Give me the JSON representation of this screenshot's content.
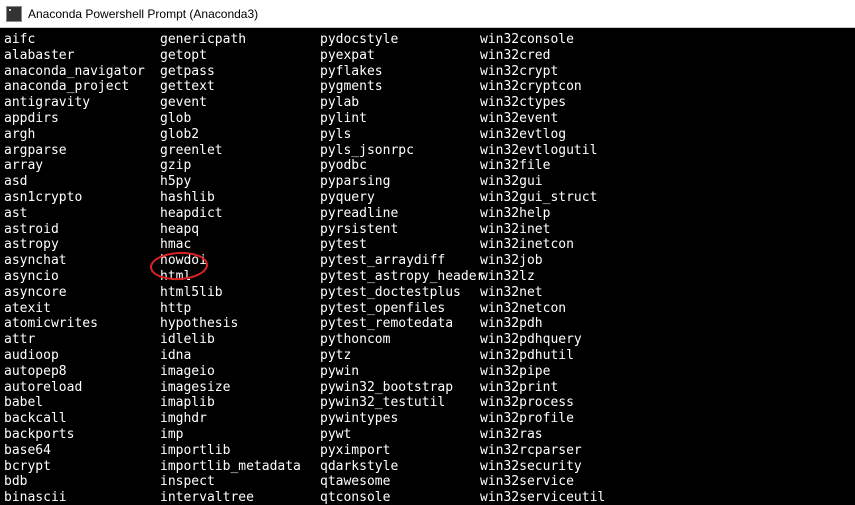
{
  "window": {
    "title": "Anaconda Powershell Prompt (Anaconda3)"
  },
  "modules": {
    "col1": [
      "aifc",
      "alabaster",
      "anaconda_navigator",
      "anaconda_project",
      "antigravity",
      "appdirs",
      "argh",
      "argparse",
      "array",
      "asd",
      "asn1crypto",
      "ast",
      "astroid",
      "astropy",
      "asynchat",
      "asyncio",
      "asyncore",
      "atexit",
      "atomicwrites",
      "attr",
      "audioop",
      "autopep8",
      "autoreload",
      "babel",
      "backcall",
      "backports",
      "base64",
      "bcrypt",
      "bdb",
      "binascii"
    ],
    "col2": [
      "genericpath",
      "getopt",
      "getpass",
      "gettext",
      "gevent",
      "glob",
      "glob2",
      "greenlet",
      "gzip",
      "h5py",
      "hashlib",
      "heapdict",
      "heapq",
      "hmac",
      "howdoi",
      "html",
      "html5lib",
      "http",
      "hypothesis",
      "idlelib",
      "idna",
      "imageio",
      "imagesize",
      "imaplib",
      "imghdr",
      "imp",
      "importlib",
      "importlib_metadata",
      "inspect",
      "intervaltree"
    ],
    "col3": [
      "pydocstyle",
      "pyexpat",
      "pyflakes",
      "pygments",
      "pylab",
      "pylint",
      "pyls",
      "pyls_jsonrpc",
      "pyodbc",
      "pyparsing",
      "pyquery",
      "pyreadline",
      "pyrsistent",
      "pytest",
      "pytest_arraydiff",
      "pytest_astropy_header",
      "pytest_doctestplus",
      "pytest_openfiles",
      "pytest_remotedata",
      "pythoncom",
      "pytz",
      "pywin",
      "pywin32_bootstrap",
      "pywin32_testutil",
      "pywintypes",
      "pywt",
      "pyximport",
      "qdarkstyle",
      "qtawesome",
      "qtconsole"
    ],
    "col4": [
      "win32console",
      "win32cred",
      "win32crypt",
      "win32cryptcon",
      "win32ctypes",
      "win32event",
      "win32evtlog",
      "win32evtlogutil",
      "win32file",
      "win32gui",
      "win32gui_struct",
      "win32help",
      "win32inet",
      "win32inetcon",
      "win32job",
      "win32lz",
      "win32net",
      "win32netcon",
      "win32pdh",
      "win32pdhquery",
      "win32pdhutil",
      "win32pipe",
      "win32print",
      "win32process",
      "win32profile",
      "win32ras",
      "win32rcparser",
      "win32security",
      "win32service",
      "win32serviceutil"
    ]
  },
  "highlighted_module": "howdoi"
}
